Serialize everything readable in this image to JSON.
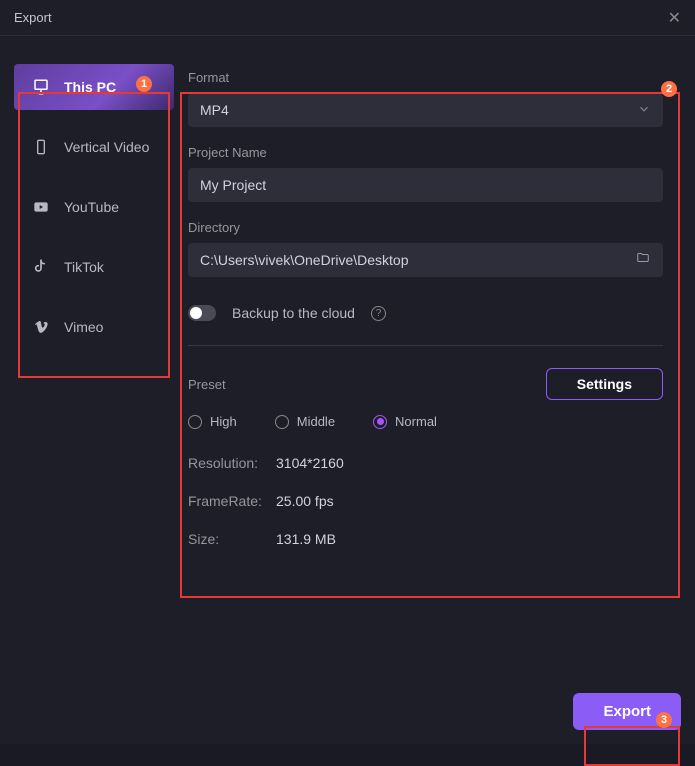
{
  "title": "Export",
  "sidebar": {
    "items": [
      {
        "label": "This PC",
        "active": true
      },
      {
        "label": "Vertical Video",
        "active": false
      },
      {
        "label": "YouTube",
        "active": false
      },
      {
        "label": "TikTok",
        "active": false
      },
      {
        "label": "Vimeo",
        "active": false
      }
    ]
  },
  "form": {
    "format_label": "Format",
    "format_value": "MP4",
    "project_label": "Project Name",
    "project_value": "My Project",
    "directory_label": "Directory",
    "directory_value": "C:\\Users\\vivek\\OneDrive\\Desktop",
    "backup_label": "Backup to the cloud"
  },
  "preset": {
    "label": "Preset",
    "settings_button": "Settings",
    "options": [
      {
        "label": "High",
        "checked": false
      },
      {
        "label": "Middle",
        "checked": false
      },
      {
        "label": "Normal",
        "checked": true
      }
    ]
  },
  "info": {
    "resolution_label": "Resolution:",
    "resolution_value": "3104*2160",
    "framerate_label": "FrameRate:",
    "framerate_value": "25.00 fps",
    "size_label": "Size:",
    "size_value": "131.9 MB"
  },
  "export_button": "Export",
  "annotations": {
    "b1": "1",
    "b2": "2",
    "b3": "3"
  }
}
